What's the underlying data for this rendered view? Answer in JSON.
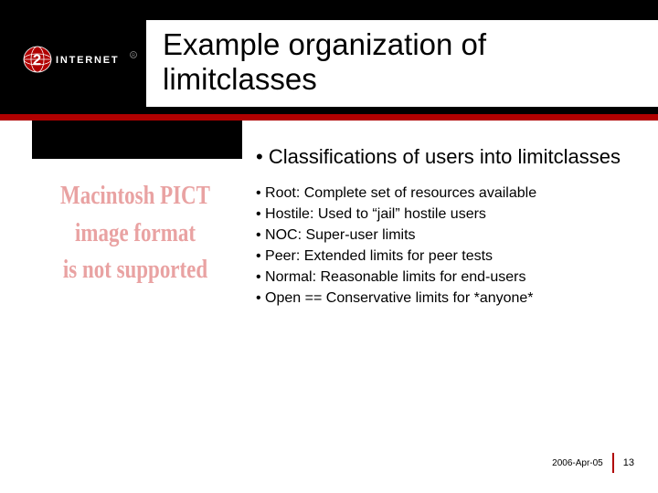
{
  "logo": {
    "brand_left": "INTERNET",
    "brand_digit": "2"
  },
  "title": {
    "line1": "Example organization of",
    "line2": "limitclasses"
  },
  "pict": {
    "line1": "Macintosh PICT",
    "line2": "image format",
    "line3": "is not supported"
  },
  "content": {
    "heading": "Classifications of users into limitclasses",
    "items": [
      "Root: Complete set of resources available",
      "Hostile: Used to “jail” hostile users",
      "NOC: Super-user limits",
      "Peer: Extended limits for peer tests",
      "Normal: Reasonable limits for end-users",
      "Open == Conservative limits for *anyone*"
    ]
  },
  "footer": {
    "date": "2006-Apr-05",
    "page": "13"
  },
  "colors": {
    "accent": "#b00000"
  }
}
